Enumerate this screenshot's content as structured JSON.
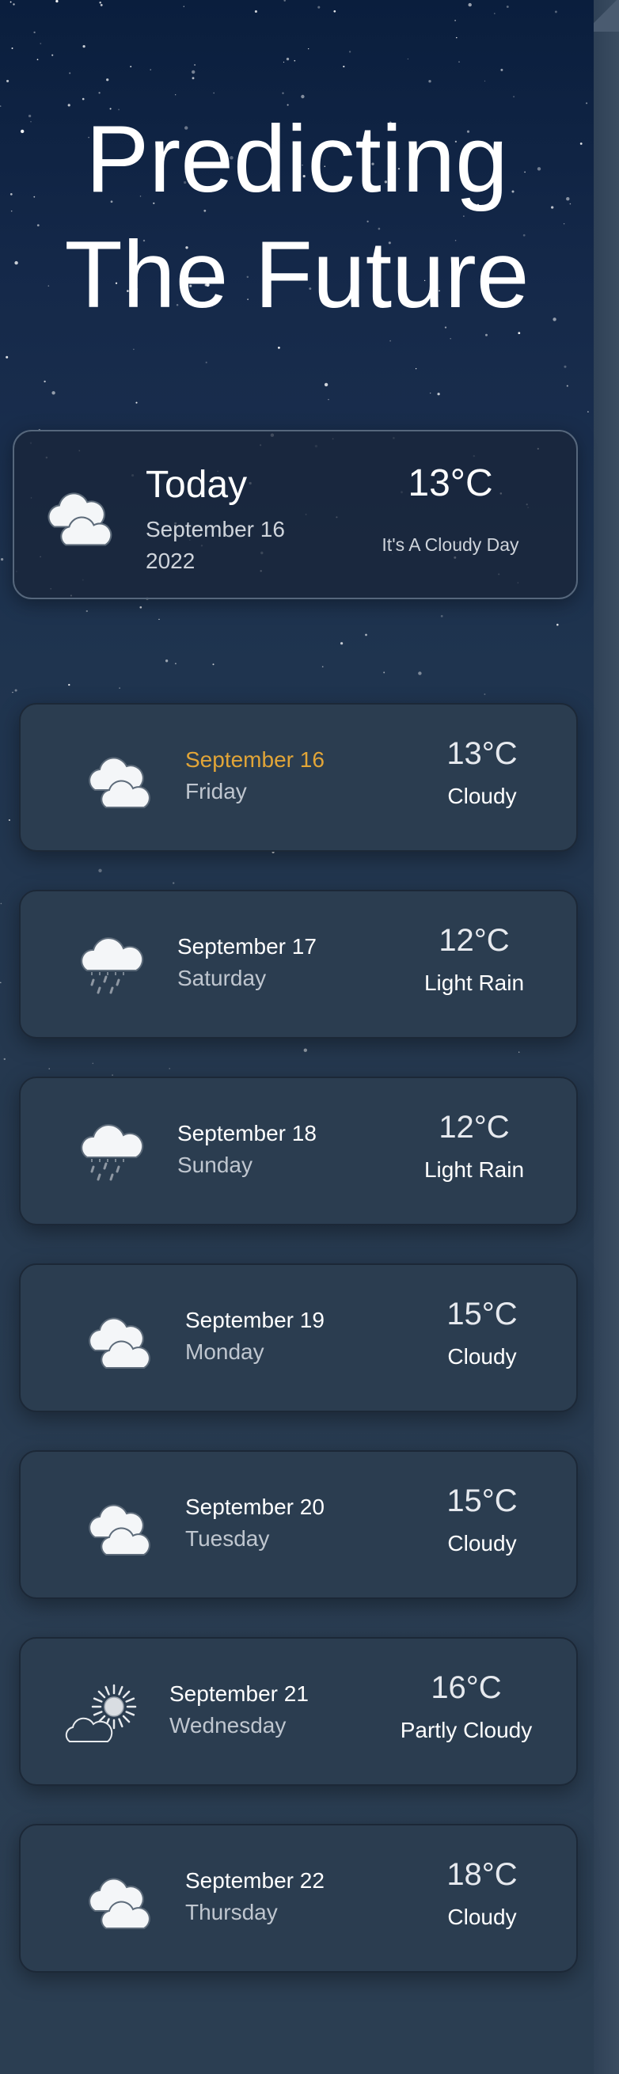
{
  "hero": {
    "title_line1": "Predicting",
    "title_line2": "The Future"
  },
  "today": {
    "label": "Today",
    "date": "September 16 2022",
    "temperature": "13°C",
    "description": "It's A Cloudy Day",
    "icon": "cloudy-icon"
  },
  "forecast": [
    {
      "date": "September 16",
      "weekday": "Friday",
      "temperature": "13°C",
      "condition": "Cloudy",
      "icon": "cloudy-icon",
      "highlight": true
    },
    {
      "date": "September 17",
      "weekday": "Saturday",
      "temperature": "12°C",
      "condition": "Light Rain",
      "icon": "rain-icon",
      "highlight": false
    },
    {
      "date": "September 18",
      "weekday": "Sunday",
      "temperature": "12°C",
      "condition": "Light Rain",
      "icon": "rain-icon",
      "highlight": false
    },
    {
      "date": "September 19",
      "weekday": "Monday",
      "temperature": "15°C",
      "condition": "Cloudy",
      "icon": "cloudy-icon",
      "highlight": false
    },
    {
      "date": "September 20",
      "weekday": "Tuesday",
      "temperature": "15°C",
      "condition": "Cloudy",
      "icon": "cloudy-icon",
      "highlight": false
    },
    {
      "date": "September 21",
      "weekday": "Wednesday",
      "temperature": "16°C",
      "condition": "Partly Cloudy",
      "icon": "partly-cloudy-icon",
      "highlight": false
    },
    {
      "date": "September 22",
      "weekday": "Thursday",
      "temperature": "18°C",
      "condition": "Cloudy",
      "icon": "cloudy-icon",
      "highlight": false
    }
  ],
  "colors": {
    "highlight_date": "#e2a537",
    "card_background": "#2b3d50",
    "page_top": "#0a1e3d",
    "page_bottom": "#2b3e52"
  }
}
